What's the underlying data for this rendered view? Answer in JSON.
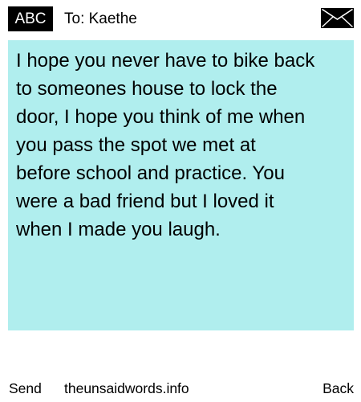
{
  "header": {
    "mode_label": "ABC",
    "recipient": "To: Kaethe",
    "send_icon": "envelope-icon"
  },
  "message": {
    "text": "I hope you never have to bike back\nto someones house to lock the\ndoor, I hope you think of me when\nyou pass the spot we met at\nbefore school and practice. You\nwere a bad friend but I loved it\nwhen I made you laugh.",
    "background_color": "#b0eeee"
  },
  "footer": {
    "send_label": "Send",
    "site_label": "theunsaidwords.info",
    "back_label": "Back"
  }
}
